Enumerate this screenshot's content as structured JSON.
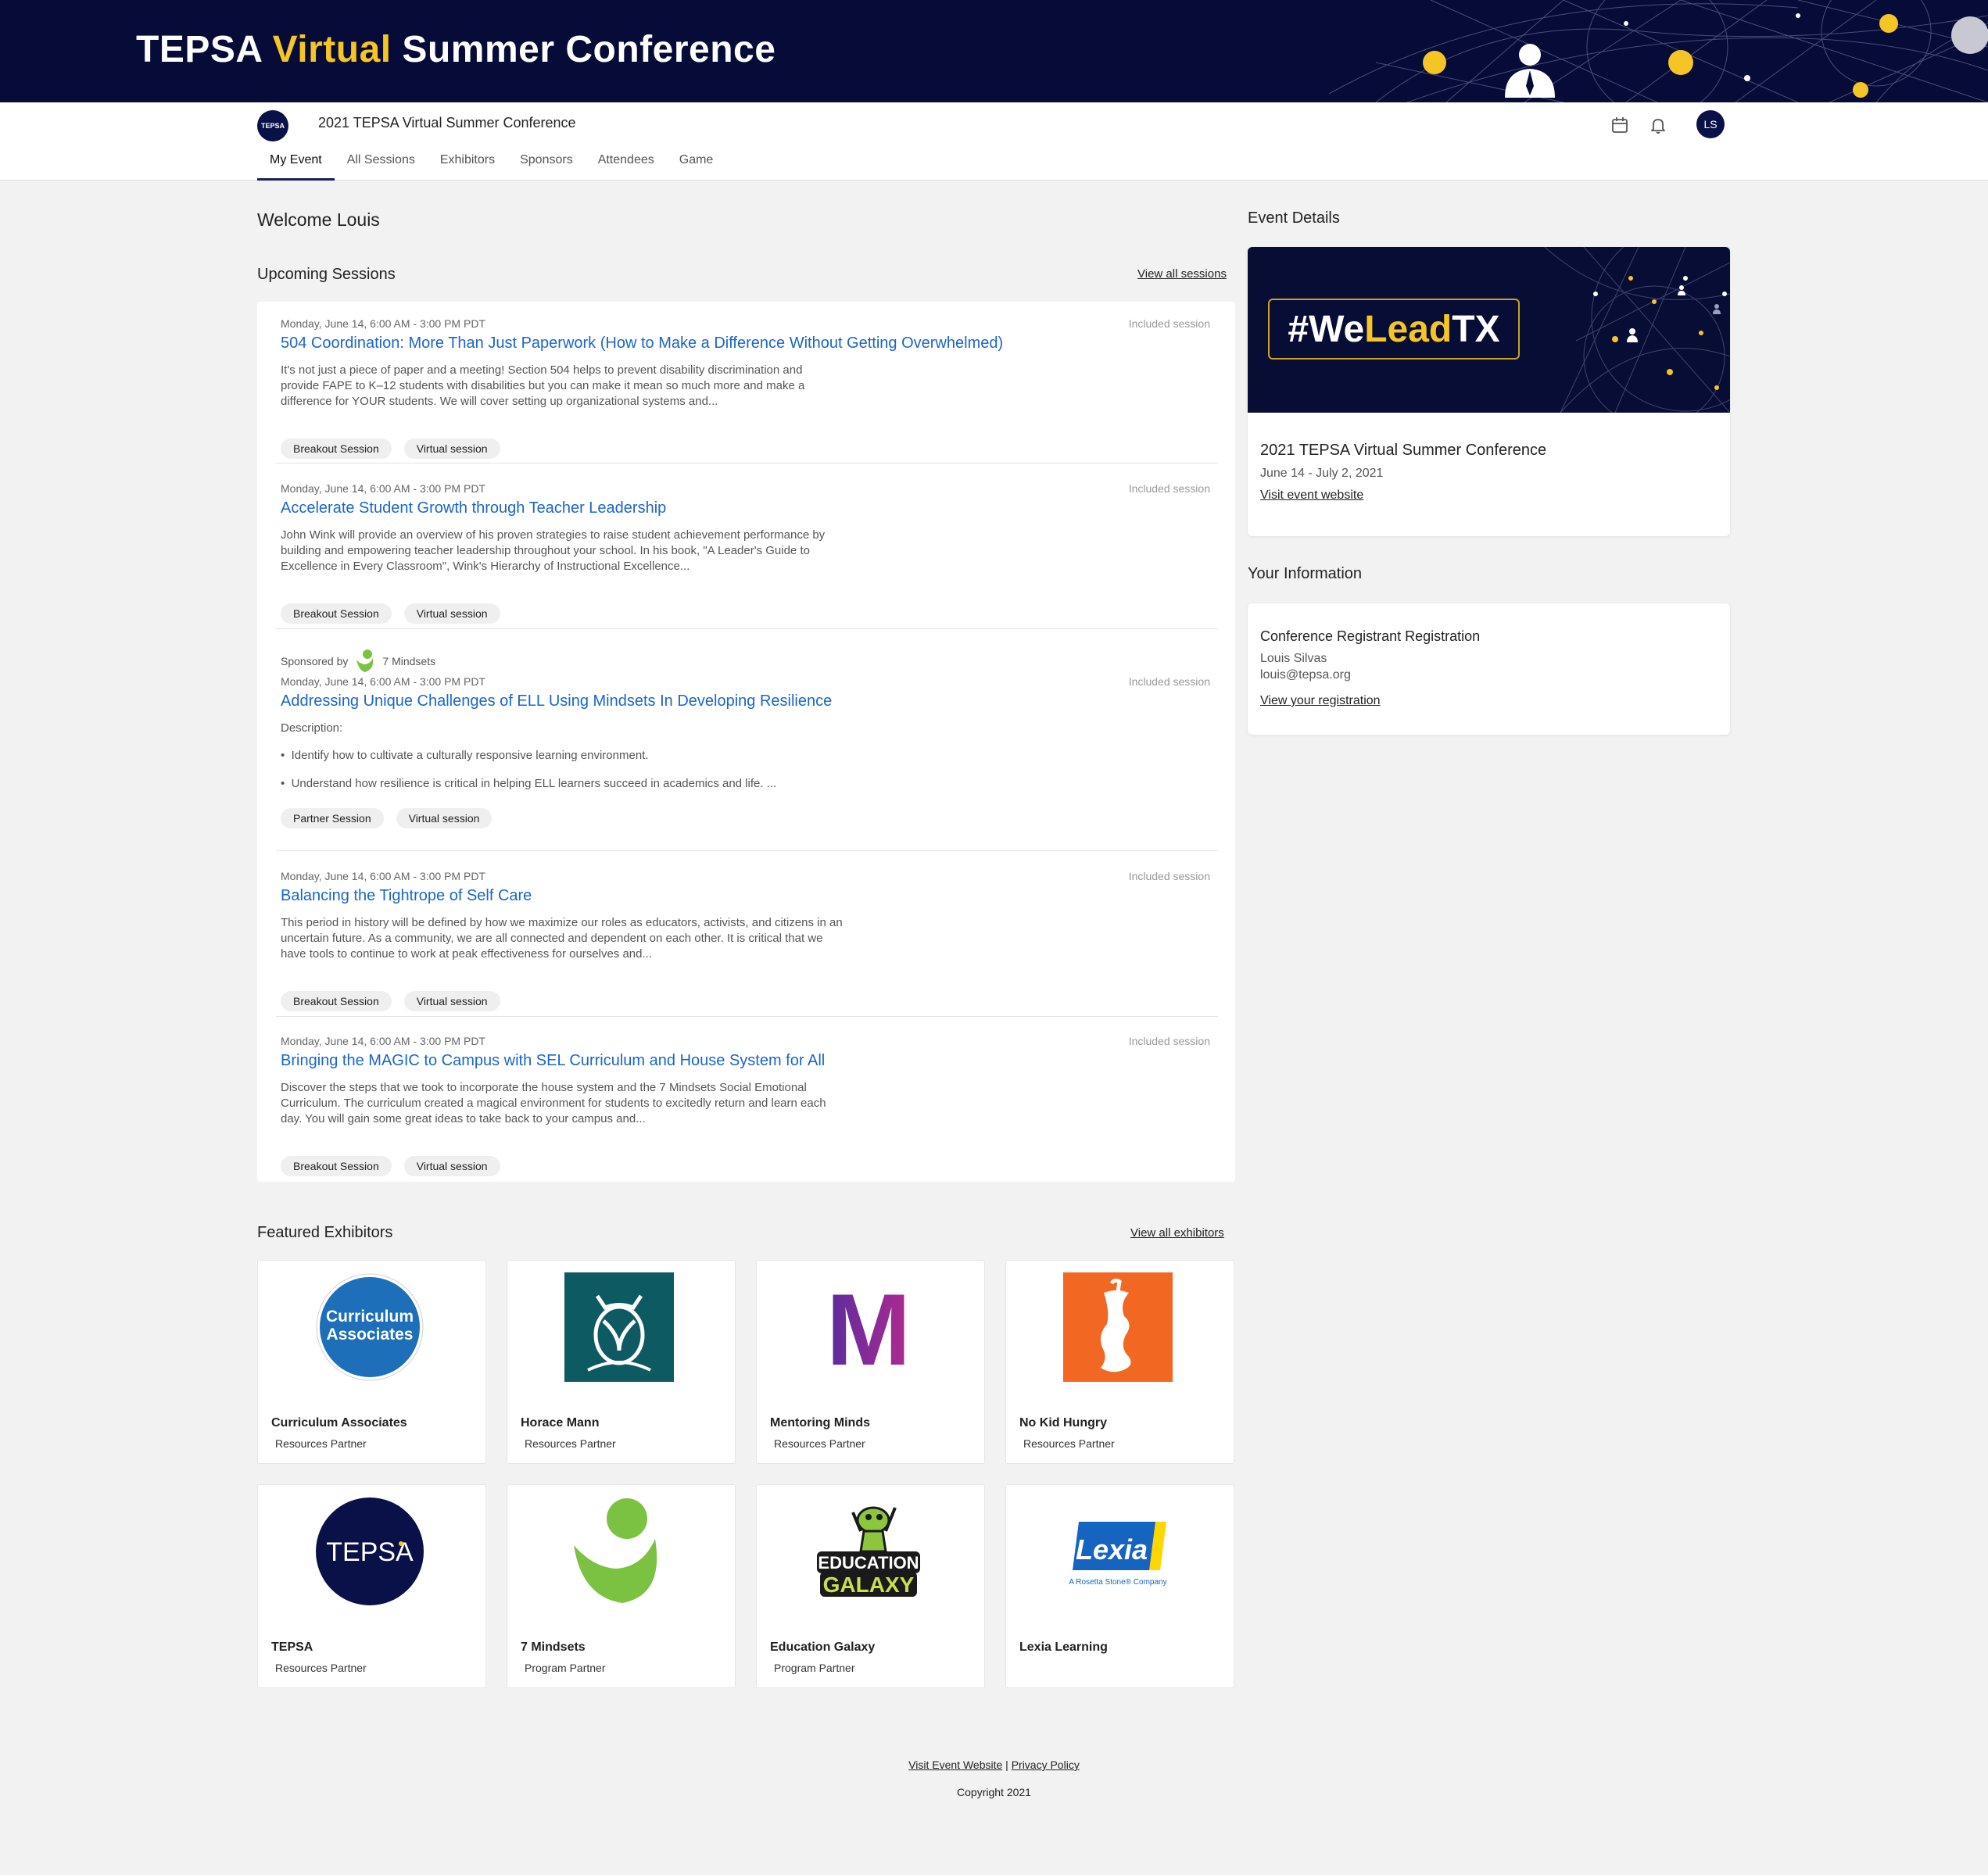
{
  "banner": {
    "title_part1": "TEPSA ",
    "title_highlight": "Virtual",
    "title_part2": " Summer Conference"
  },
  "header": {
    "logo_text": "TEPSA",
    "event_name": "2021 TEPSA Virtual Summer Conference",
    "avatar_initials": "LS",
    "nav": [
      "My Event",
      "All Sessions",
      "Exhibitors",
      "Sponsors",
      "Attendees",
      "Game"
    ]
  },
  "main": {
    "welcome": "Welcome Louis",
    "upcoming_title": "Upcoming Sessions",
    "view_all_sessions": "View all sessions",
    "sessions": [
      {
        "time": "Monday, June 14, 6:00 AM - 3:00 PM PDT",
        "included": "Included session",
        "title": "504 Coordination: More Than Just Paperwork (How to Make a Difference Without Getting Overwhelmed)",
        "desc": "It's not just a piece of paper and a meeting! Section 504 helps to prevent disability discrimination and provide FAPE to K–12 students with disabilities but you can make it mean so much more and make a difference for YOUR students. We will cover setting up organizational systems and...",
        "tags": [
          "Breakout Session",
          "Virtual session"
        ]
      },
      {
        "time": "Monday, June 14, 6:00 AM - 3:00 PM PDT",
        "included": "Included session",
        "title": "Accelerate Student Growth through Teacher Leadership",
        "desc": "John Wink will provide an overview of his proven strategies to raise student achievement performance by building and empowering teacher leadership throughout your school. In his book, \"A Leader's Guide to Excellence in Every Classroom\", Wink's Hierarchy of Instructional Excellence...",
        "tags": [
          "Breakout Session",
          "Virtual session"
        ]
      },
      {
        "sponsored_label": "Sponsored by",
        "sponsor_name": "7 Mindsets",
        "time": "Monday, June 14, 6:00 AM - 3:00 PM PDT",
        "included": "Included session",
        "title": "Addressing Unique Challenges of ELL Using Mindsets In Developing Resilience",
        "desc_label": "Description:",
        "bullets": [
          "Identify how to cultivate a culturally responsive learning  environment.",
          "Understand how resilience is critical in helping ELL learners succeed  in academics and life.   ..."
        ],
        "tags": [
          "Partner Session",
          "Virtual session"
        ]
      },
      {
        "time": "Monday, June 14, 6:00 AM - 3:00 PM PDT",
        "included": "Included session",
        "title": "Balancing the Tightrope of Self Care",
        "desc": "This period in history will be defined by how we maximize our roles as educators, activists, and citizens in an uncertain future. As a community, we are all connected and dependent on each other. It is critical that we have tools to continue to work at peak effectiveness for ourselves and...",
        "tags": [
          "Breakout Session",
          "Virtual session"
        ]
      },
      {
        "time": "Monday, June 14, 6:00 AM - 3:00 PM PDT",
        "included": "Included session",
        "title": "Bringing the MAGIC to Campus with SEL Curriculum and House System for All",
        "desc": "Discover the steps that we took to incorporate the house system and the 7 Mindsets Social Emotional Curriculum. The curriculum created a magical environment for students to excitedly return and learn each day. You will gain some great ideas to take back to your campus and...",
        "tags": [
          "Breakout Session",
          "Virtual session"
        ]
      }
    ],
    "exhibitors_title": "Featured Exhibitors",
    "view_all_exhibitors": "View all exhibitors",
    "exhibitors": [
      {
        "name": "Curriculum Associates",
        "type": "Resources Partner",
        "logo_text": "Curriculum Associates"
      },
      {
        "name": "Horace Mann",
        "type": "Resources Partner"
      },
      {
        "name": "Mentoring Minds",
        "type": "Resources Partner",
        "logo_text": "M"
      },
      {
        "name": "No Kid Hungry",
        "type": "Resources Partner"
      },
      {
        "name": "TEPSA",
        "type": "Resources Partner",
        "logo_text": "TEPSA"
      },
      {
        "name": "7 Mindsets",
        "type": "Program Partner"
      },
      {
        "name": "Education Galaxy",
        "type": "Program Partner",
        "logo_text": "EDUCATION GALAXY"
      },
      {
        "name": "Lexia Learning",
        "type": "",
        "logo_text": "Lexia",
        "logo_sub": "A Rosetta Stone® Company"
      }
    ]
  },
  "sidebar": {
    "event_details_title": "Event Details",
    "hashtag_part1": "#We",
    "hashtag_highlight": "Lead",
    "hashtag_part2": "TX",
    "event_name": "2021 TEPSA Virtual Summer Conference",
    "dates": "June 14 - July 2, 2021",
    "visit_link": "Visit event website",
    "your_info_title": "Your Information",
    "registration_type": "Conference Registrant Registration",
    "user_name": "Louis Silvas",
    "user_email": "louis@tepsa.org",
    "view_registration": "View your registration"
  },
  "footer": {
    "visit_link": "Visit Event Website",
    "separator": "|",
    "privacy_link": "Privacy Policy",
    "copyright": "Copyright 2021"
  },
  "colors": {
    "navy": "#060b37",
    "gold": "#f5c526",
    "link_blue": "#1a66c9"
  }
}
